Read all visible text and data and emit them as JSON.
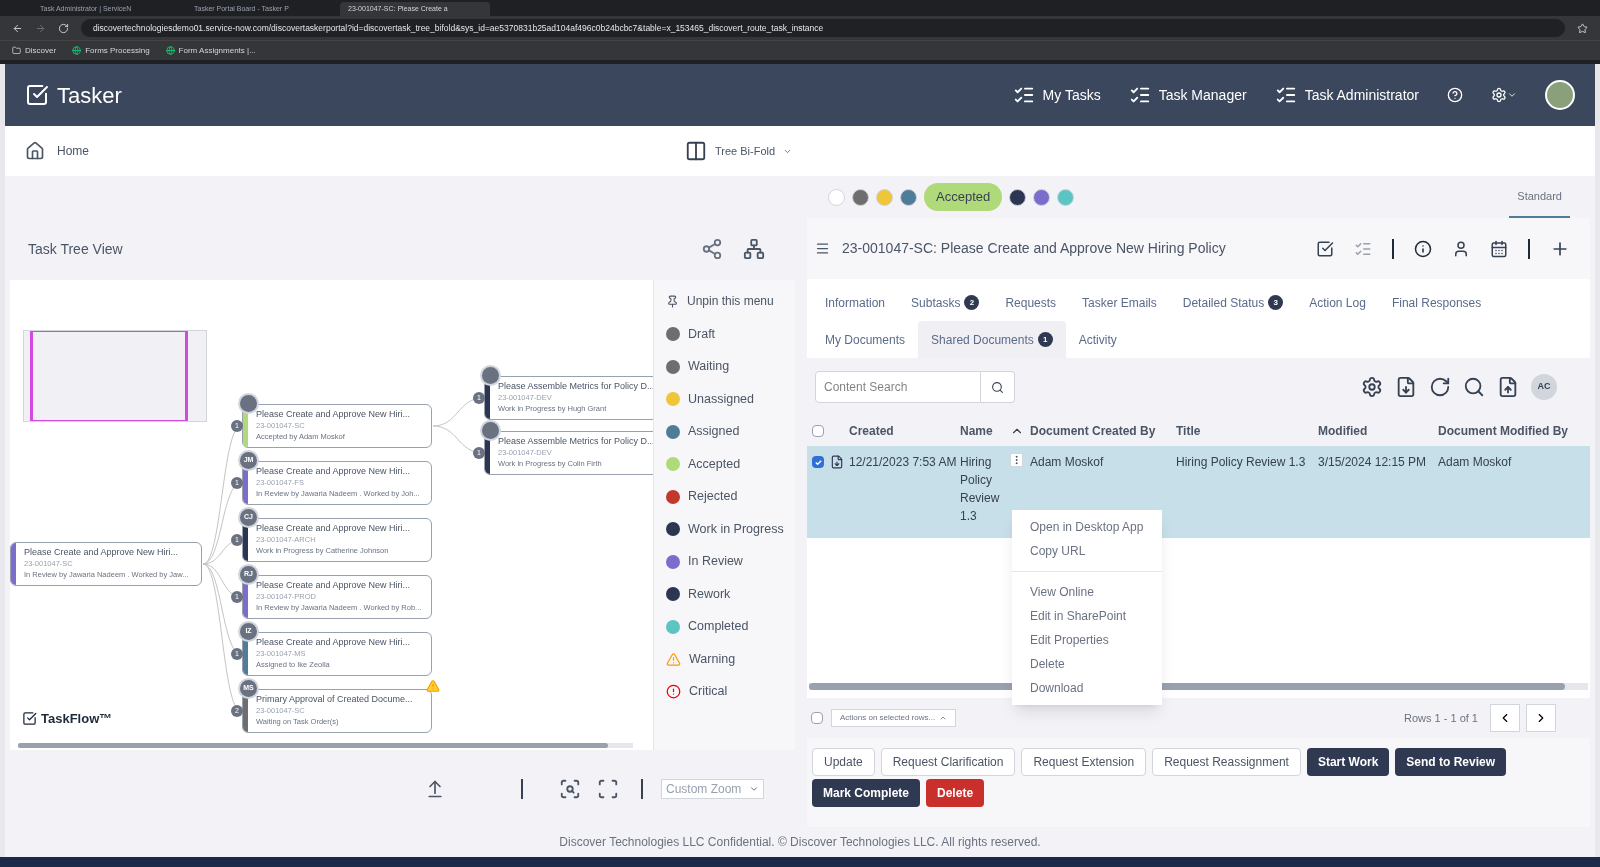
{
  "browser": {
    "tabs": [
      {
        "title": "Task Administrator | ServiceN",
        "selected": false
      },
      {
        "title": "Tasker Portal Board - Tasker P",
        "selected": false
      },
      {
        "title": "23-001047-SC: Please Create a",
        "selected": true
      }
    ],
    "url": "discovertechnologiesdemo01.service-now.com/discovertaskerportal?id=discovertask_tree_bifold&sys_id=ae5370831b25ad104af496c0b24bcbc7&table=x_153465_discovert_route_task_instance",
    "bookmarks": [
      {
        "label": "Discover",
        "kind": "folder"
      },
      {
        "label": "Forms Processing",
        "kind": "site"
      },
      {
        "label": "Form Assignments |...",
        "kind": "site"
      }
    ]
  },
  "app": {
    "brand": "Tasker",
    "nav": [
      {
        "label": "My Tasks"
      },
      {
        "label": "Task Manager"
      },
      {
        "label": "Task Administrator"
      }
    ]
  },
  "subheader": {
    "home": "Home",
    "view": "Tree Bi-Fold"
  },
  "status_filters": [
    {
      "kind": "dot",
      "color": "#ffffff"
    },
    {
      "kind": "dot",
      "color": "#6e6e6e"
    },
    {
      "kind": "dot",
      "color": "#efc53a"
    },
    {
      "kind": "dot",
      "color": "#4f7d99"
    },
    {
      "kind": "pill",
      "color": "#b0d97a",
      "label": "Accepted"
    },
    {
      "kind": "dot",
      "color": "#2c3652"
    },
    {
      "kind": "dot",
      "color": "#7a6dcc"
    },
    {
      "kind": "dot",
      "color": "#5cc4c2"
    }
  ],
  "view_mode": {
    "label": "Standard",
    "selected": true
  },
  "tree_panel": {
    "title": "Task Tree View",
    "logo": "TaskFlow™",
    "root": {
      "title": "Please Create and Approve New Hiri...",
      "code": "23-001047-SC",
      "status": "In Review by Jawaria Nadeem . Worked by Jaw...",
      "color": "#7a6dcc",
      "children": [
        {
          "title": "Please Create and Approve New Hiri...",
          "code": "23-001047-SC",
          "status": "Accepted by Adam Moskof",
          "color": "#b0d97a",
          "count": "1",
          "warning": false,
          "children": [
            {
              "title": "Please Assemble Metrics for Policy D...",
              "code": "23-001047-DEV",
              "status": "Work in Progress by Hugh Grant",
              "color": "#2c3652",
              "count": "1"
            },
            {
              "title": "Please Assemble Metrics for Policy D...",
              "code": "23-001047-DEV",
              "status": "Work in Progress by Colin Firth",
              "color": "#2c3652",
              "count": "1"
            }
          ]
        },
        {
          "title": "Please Create and Approve New Hiri...",
          "code": "23-001047-FS",
          "status": "In Review by Jawaria Nadeem . Worked by Joh...",
          "color": "#7a6dcc",
          "count": "1",
          "initials": "JM",
          "warning": false
        },
        {
          "title": "Please Create and Approve New Hiri...",
          "code": "23-001047-ARCH",
          "status": "Work in Progress by Catherine Johnson",
          "color": "#2c3652",
          "count": "1",
          "initials": "CJ",
          "warning": false
        },
        {
          "title": "Please Create and Approve New Hiri...",
          "code": "23-001047-PROD",
          "status": "In Review by Jawaria Nadeem . Worked by Rob...",
          "color": "#7a6dcc",
          "count": "1",
          "initials": "RJ",
          "warning": false
        },
        {
          "title": "Please Create and Approve New Hiri...",
          "code": "23-001047-MS",
          "status": "Assigned to Ike Zeolla",
          "color": "#4f7d99",
          "count": "1",
          "initials": "IZ",
          "warning": false
        },
        {
          "title": "Primary Approval of Created Docume...",
          "code": "23-001047-SC",
          "status": "Waiting on Task Order(s)",
          "color": "#6e6e6e",
          "count": "2",
          "initials": "MS",
          "warning": true
        }
      ]
    },
    "legend": {
      "unpin": "Unpin this menu",
      "items": [
        {
          "kind": "dot",
          "label": "Draft",
          "color": "#6e6e6e"
        },
        {
          "kind": "dot",
          "label": "Waiting",
          "color": "#6e6e6e"
        },
        {
          "kind": "dot",
          "label": "Unassigned",
          "color": "#efc53a"
        },
        {
          "kind": "dot",
          "label": "Assigned",
          "color": "#4f7d99"
        },
        {
          "kind": "dot",
          "label": "Accepted",
          "color": "#b0d97a"
        },
        {
          "kind": "dot",
          "label": "Rejected",
          "color": "#c0392b"
        },
        {
          "kind": "dot",
          "label": "Work in Progress",
          "color": "#2c3652"
        },
        {
          "kind": "dot",
          "label": "In Review",
          "color": "#7a6dcc"
        },
        {
          "kind": "dot",
          "label": "Rework",
          "color": "#2c3652"
        },
        {
          "kind": "dot",
          "label": "Completed",
          "color": "#5cc4c2"
        },
        {
          "kind": "warning",
          "label": "Warning"
        },
        {
          "kind": "critical",
          "label": "Critical"
        }
      ]
    },
    "zoom_select": "Custom Zoom"
  },
  "task_panel": {
    "title": "23-001047-SC: Please Create and Approve New Hiring Policy",
    "tabs": [
      {
        "label": "Information",
        "selected": false
      },
      {
        "label": "Subtasks",
        "badge": "2",
        "selected": false
      },
      {
        "label": "Requests",
        "selected": false
      },
      {
        "label": "Tasker Emails",
        "selected": false
      },
      {
        "label": "Detailed Status",
        "badge": "3",
        "selected": false
      },
      {
        "label": "Action Log",
        "selected": false
      },
      {
        "label": "Final Responses",
        "selected": false
      },
      {
        "label": "My Documents",
        "selected": false
      },
      {
        "label": "Shared Documents",
        "badge": "1",
        "selected": true
      },
      {
        "label": "Activity",
        "selected": false
      }
    ],
    "search": {
      "placeholder": "Content Search"
    },
    "avatar": "AC",
    "table": {
      "select_all": {
        "checked": false
      },
      "columns": [
        "Created",
        "Name",
        "Document Created By",
        "Title",
        "Modified",
        "Document Modified By"
      ],
      "rows": [
        {
          "checked": true,
          "selected": true,
          "cells": [
            "12/21/2023 7:53 AM",
            "Hiring Policy Review 1.3",
            "Adam Moskof",
            "Hiring Policy Review 1.3",
            "3/15/2024 12:15 PM",
            "Adam Moskof"
          ]
        }
      ]
    },
    "context_menu": [
      {
        "items": [
          "Open in Desktop App",
          "Copy URL"
        ]
      },
      {
        "items": [
          "View Online",
          "Edit in SharePoint",
          "Edit Properties",
          "Delete",
          "Download"
        ]
      }
    ],
    "bulk_select": {
      "checked": false
    },
    "bulk_actions": "Actions on selected rows...",
    "rows_info": "Rows 1 - 1 of 1",
    "buttons": [
      {
        "label": "Update",
        "kind": "outline"
      },
      {
        "label": "Request Clarification",
        "kind": "outline"
      },
      {
        "label": "Request Extension",
        "kind": "outline"
      },
      {
        "label": "Request Reassignment",
        "kind": "outline"
      },
      {
        "label": "Start Work",
        "kind": "dark"
      },
      {
        "label": "Send to Review",
        "kind": "dark"
      },
      {
        "label": "Mark Complete",
        "kind": "dark"
      },
      {
        "label": "Delete",
        "kind": "danger"
      }
    ]
  },
  "footer": "Discover Technologies LLC Confidential. © Discover Technologies LLC. All rights reserved."
}
